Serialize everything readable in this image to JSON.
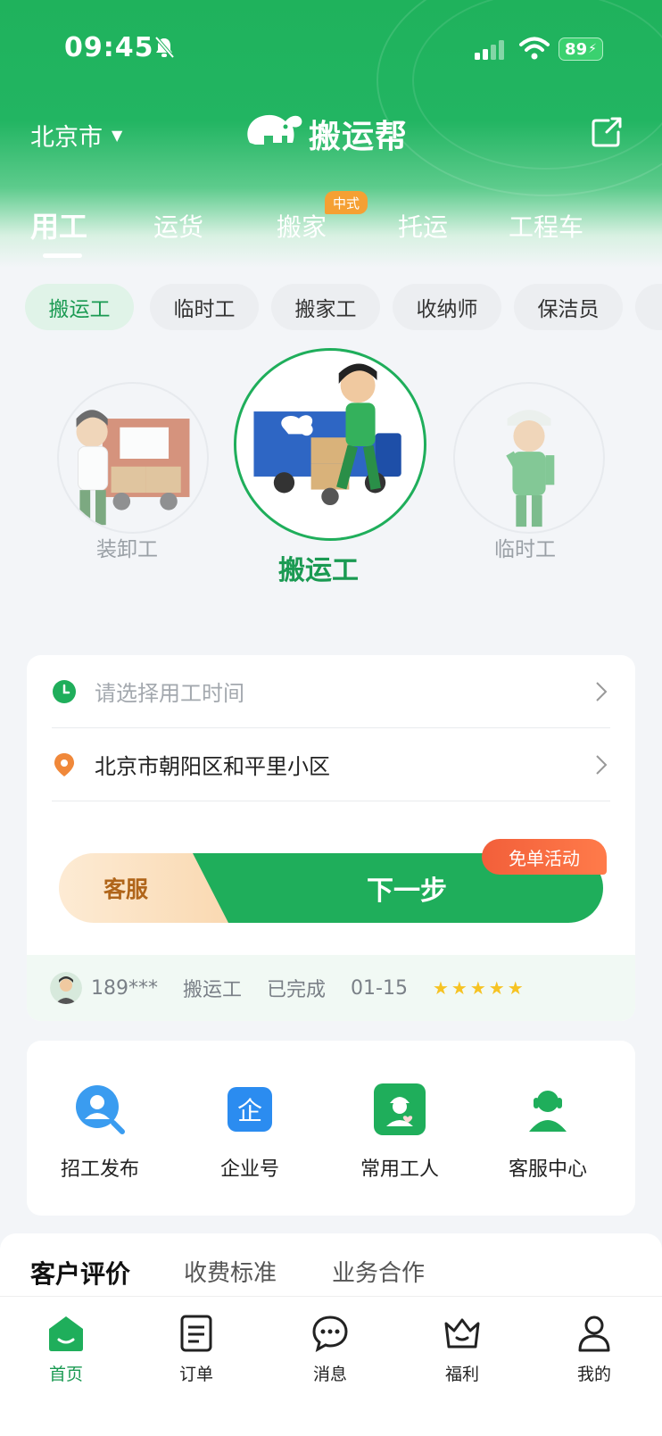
{
  "status_bar": {
    "time": "09:45",
    "battery": "89"
  },
  "header": {
    "city": "北京市",
    "logo_text": "搬运帮"
  },
  "main_tabs": [
    {
      "label": "用工",
      "active": true
    },
    {
      "label": "运货"
    },
    {
      "label": "搬家",
      "badge": "中式"
    },
    {
      "label": "托运"
    },
    {
      "label": "工程车"
    }
  ],
  "sub_tabs": [
    {
      "label": "搬运工",
      "active": true
    },
    {
      "label": "临时工"
    },
    {
      "label": "搬家工"
    },
    {
      "label": "收纳师"
    },
    {
      "label": "保洁员"
    }
  ],
  "carousel": {
    "left": "装卸工",
    "center": "搬运工",
    "right": "临时工"
  },
  "booking": {
    "time_placeholder": "请选择用工时间",
    "address": "北京市朝阳区和平里小区",
    "service_label": "客服",
    "next_label": "下一步",
    "promo_label": "免单活动"
  },
  "recent_order": {
    "phone": "189***",
    "type": "搬运工",
    "status": "已完成",
    "date": "01-15",
    "rating": 5
  },
  "shortcuts": [
    {
      "label": "招工发布",
      "icon": "recruit-search-icon"
    },
    {
      "label": "企业号",
      "icon": "enterprise-icon"
    },
    {
      "label": "常用工人",
      "icon": "favorite-worker-icon"
    },
    {
      "label": "客服中心",
      "icon": "customer-service-icon"
    }
  ],
  "section_tabs": [
    {
      "label": "客户评价",
      "active": true
    },
    {
      "label": "收费标准"
    },
    {
      "label": "业务合作"
    }
  ],
  "bottom_nav": [
    {
      "label": "首页",
      "active": true,
      "icon": "home-icon"
    },
    {
      "label": "订单",
      "icon": "order-icon"
    },
    {
      "label": "消息",
      "icon": "message-icon"
    },
    {
      "label": "福利",
      "icon": "crown-icon"
    },
    {
      "label": "我的",
      "icon": "profile-icon"
    }
  ],
  "colors": {
    "brand_green": "#1fae5b",
    "promo_orange": "#f25f3a",
    "service_orange": "#f9d8b0"
  }
}
